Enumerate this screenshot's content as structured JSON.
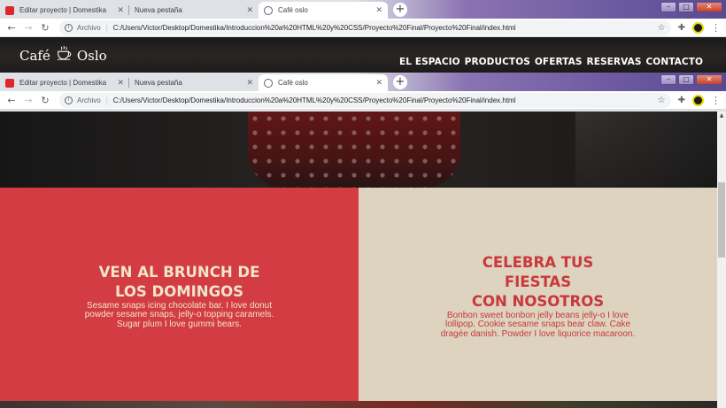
{
  "browser": {
    "tabs": [
      {
        "label": "Editar proyecto | Domestika",
        "icon": "domestika-icon"
      },
      {
        "label": "Nueva pestaña",
        "icon": ""
      },
      {
        "label": "Café oslo",
        "icon": "globe-icon"
      }
    ],
    "protocol_label": "Archivo",
    "url": "C:/Users/Victor/Desktop/Domestika/Introduccion%20a%20HTML%20y%20CSS/Proyecto%20Final/Proyecto%20Final/index.html"
  },
  "site": {
    "logo_left": "Café",
    "logo_right": "Oslo",
    "nav": [
      "EL ESPACIO",
      "PRODUCTOS",
      "OFERTAS",
      "RESERVAS",
      "CONTACTO"
    ]
  },
  "promos": {
    "left": {
      "title_line1": "VEN AL BRUNCH DE",
      "title_line2": "LOS DOMINGOS",
      "body": "Sesame snaps icing chocolate bar. I love donut powder sesame snaps, jelly-o topping caramels. Sugar plum I love gummi bears."
    },
    "right": {
      "title_line1": "CELEBRA TUS FIESTAS",
      "title_line2": "CON NOSOTROS",
      "body": "Bonbon sweet bonbon jelly beans jelly-o I love lollipop. Cookie sesame snaps bear claw. Cake dragée danish. Powder I love liquorice macaroon."
    }
  },
  "colors": {
    "brand_red": "#d23c42",
    "brand_cream": "#ddd3bf",
    "text_cream": "#f1e4cb"
  }
}
